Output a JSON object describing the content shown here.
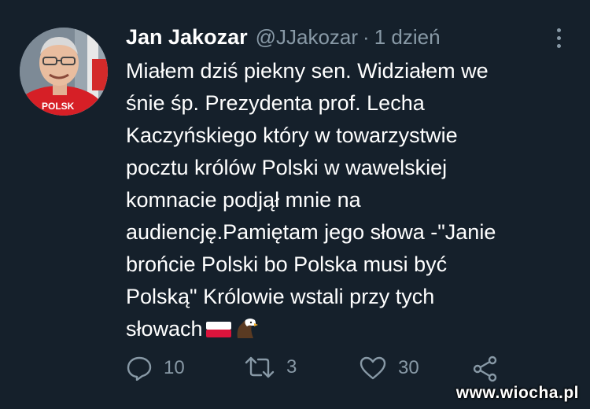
{
  "tweet": {
    "author": {
      "name": "Jan Jakozar",
      "handle": "@JJakozar",
      "separator": "·",
      "time": "1 dzień",
      "avatar_shirt_text": "POLSK"
    },
    "text_lines": [
      "Miałem dziś piekny sen. Widziałem we",
      "śnie śp. Prezydenta prof. Lecha",
      "Kaczyńskiego który w towarzystwie",
      "pocztu królów Polski w wawelskiej",
      "komnacie podjął mnie na",
      "audiencję.Pamiętam jego słowa -\"Janie",
      "brońcie Polski bo Polska musi być",
      "Polską\" Królowie wstali przy tych",
      "słowach"
    ],
    "emojis": [
      "flag-poland-icon",
      "eagle-icon"
    ],
    "actions": {
      "reply_count": "10",
      "retweet_count": "3",
      "like_count": "30"
    }
  },
  "watermark": "www.wiocha.pl",
  "colors": {
    "background": "#15202b",
    "text_primary": "#ffffff",
    "text_secondary": "#8899a6"
  }
}
